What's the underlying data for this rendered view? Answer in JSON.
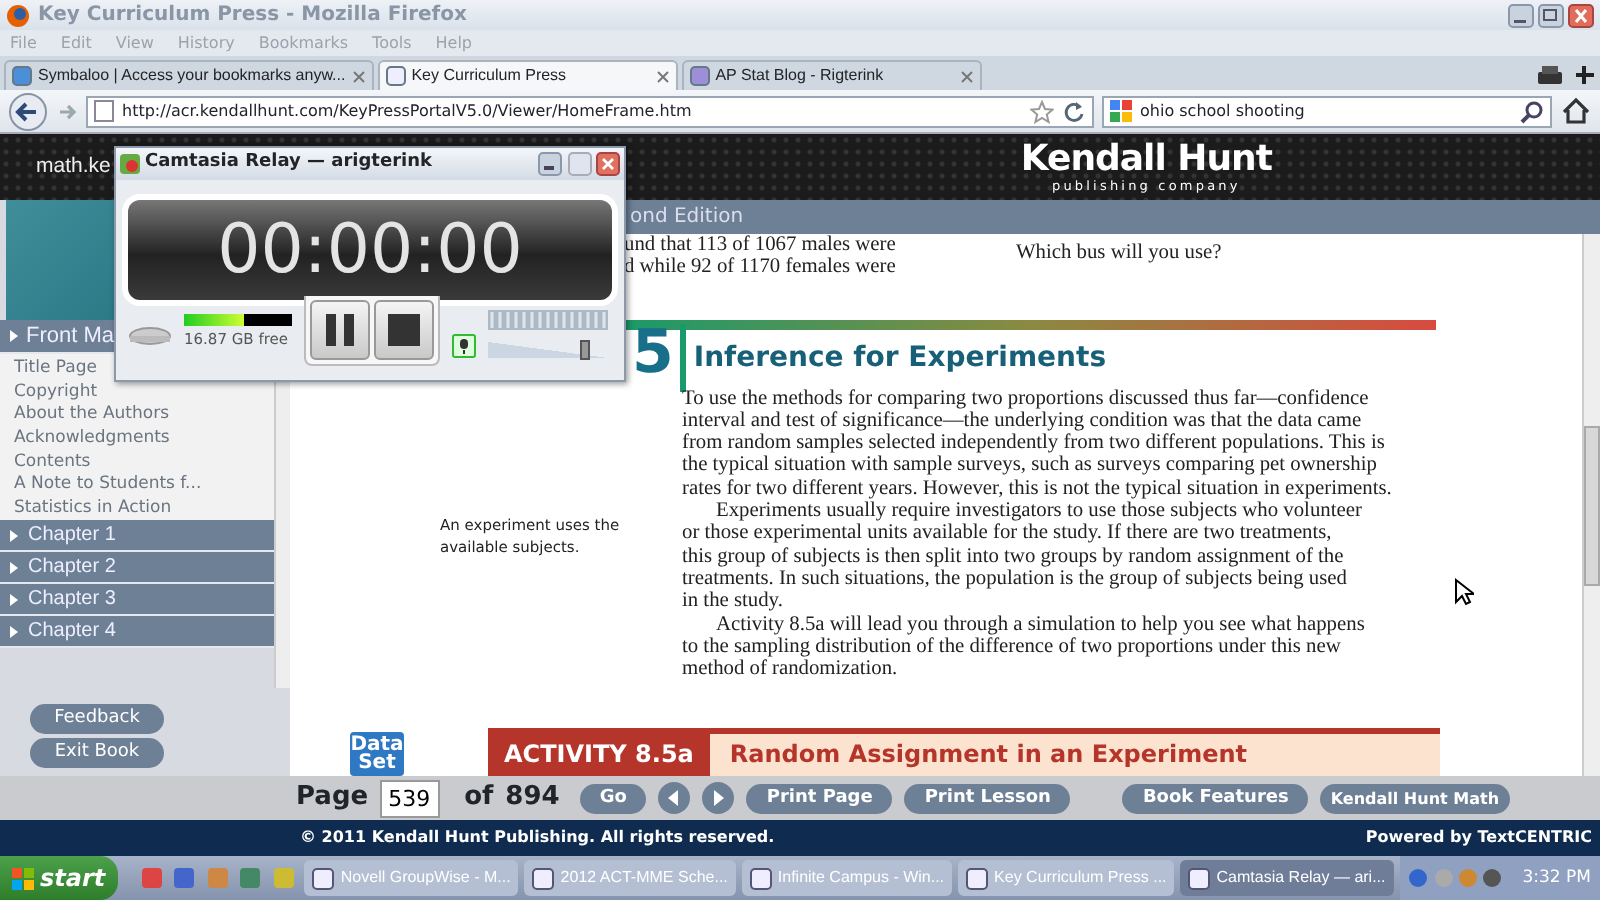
{
  "browser": {
    "title": "Key Curriculum Press - Mozilla Firefox",
    "menu": [
      "File",
      "Edit",
      "View",
      "History",
      "Bookmarks",
      "Tools",
      "Help"
    ],
    "tabs": [
      {
        "label": "Symbaloo | Access your bookmarks anyw...",
        "selected": false
      },
      {
        "label": "Key Curriculum Press",
        "selected": true
      },
      {
        "label": "AP Stat Blog - Rigterink",
        "selected": false
      }
    ],
    "url": "http://acr.kendallhunt.com/KeyPressPortalV5.0/Viewer/HomeFrame.htm",
    "search": "ohio school shooting"
  },
  "site": {
    "header_left": "math.ke",
    "logo": "Kendall Hunt",
    "logo_sub": "publishing company",
    "edition": "ond Edition"
  },
  "sidebar": {
    "header": {
      "label": "Front Ma",
      "expanded": true
    },
    "items": [
      "Title Page",
      "Copyright",
      "About the Authors",
      "Acknowledgments",
      "Contents",
      "A Note to Students f...",
      "Statistics in Action"
    ],
    "chapters": [
      {
        "label": "Chapter 1",
        "expanded": false
      },
      {
        "label": "Chapter 2",
        "expanded": false
      },
      {
        "label": "Chapter 3",
        "expanded": false
      },
      {
        "label": "Chapter 4",
        "expanded": false
      }
    ],
    "buttons": [
      "Feedback",
      "Exit Book"
    ]
  },
  "page": {
    "top_left": "und that 113 of 1067 males were\nd while 92 of 1170 females were",
    "top_right": "Which bus will you use?",
    "section_number": "5",
    "heading": "Inference for Experiments",
    "paragraphs": [
      "To use the methods for comparing two proportions discussed thus far—confidence\ninterval and test of significance—the underlying condition was that the data came\nfrom random samples selected independently from two different populations. This is\nthe typical situation with sample surveys, such as surveys comparing pet ownership\nrates for two different years. However, this is not the typical situation in experiments.",
      "Experiments usually require investigators to use those subjects who volunteer\nor those experimental units available for the study. If there are two treatments,\nthis group of subjects is then split into two groups by random assignment of the\ntreatments. In such situations, the population is the group of subjects being used\nin the study.",
      "Activity 8.5a will lead you through a simulation to help you see what happens\nto the sampling distribution of the difference of two proportions under this new\nmethod of randomization."
    ],
    "margin_note": "An experiment uses the\navailable subjects.",
    "data_set": "Data\nSet",
    "activity_label": "ACTIVITY 8.5a",
    "activity_title": "Random Assignment in an Experiment"
  },
  "nav": {
    "page_label": "Page",
    "page": "539",
    "of": "of",
    "total": "894",
    "go": "Go",
    "buttons": [
      "Print Page",
      "Print Lesson",
      "Book Features",
      "Kendall Hunt Math"
    ]
  },
  "footer": {
    "copyright": "© 2011 Kendall Hunt Publishing. All rights reserved.",
    "powered": "Powered by TextCENTRIC"
  },
  "recorder": {
    "title": "Camtasia Relay — arigterink",
    "timer": "00:00:00",
    "disk": {
      "level": 0.55,
      "reading": "16.87 GB free"
    },
    "mic_on": true,
    "volume": {
      "level": 0.82
    }
  },
  "taskbar": {
    "start": "start",
    "tasks": [
      {
        "label": "Novell GroupWise - M...",
        "selected": false
      },
      {
        "label": "2012 ACT-MME Sche...",
        "selected": false
      },
      {
        "label": "Infinite Campus - Win...",
        "selected": false
      },
      {
        "label": "Key Curriculum Press ...",
        "selected": false
      },
      {
        "label": "Camtasia Relay — ari...",
        "selected": true
      }
    ],
    "clock": "3:32 PM"
  }
}
